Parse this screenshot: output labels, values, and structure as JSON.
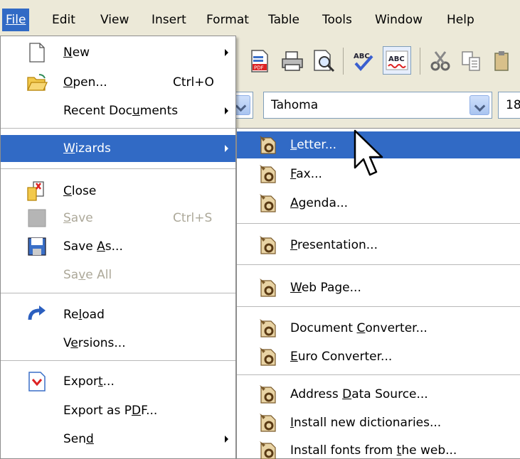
{
  "menubar": {
    "items": [
      {
        "label": "File",
        "mnemonic_index": 0
      },
      {
        "label": "Edit",
        "mnemonic_index": 0
      },
      {
        "label": "View",
        "mnemonic_index": 0
      },
      {
        "label": "Insert",
        "mnemonic_index": 0
      },
      {
        "label": "Format",
        "mnemonic_index": 1
      },
      {
        "label": "Table",
        "mnemonic_index": 1
      },
      {
        "label": "Tools",
        "mnemonic_index": 0
      },
      {
        "label": "Window",
        "mnemonic_index": 0
      },
      {
        "label": "Help",
        "mnemonic_index": 0
      }
    ]
  },
  "toolbar": {
    "font_name": "Tahoma",
    "font_size": "18"
  },
  "file_menu": {
    "items": [
      {
        "label": "New",
        "ul": "N",
        "pre": "",
        "post": "ew",
        "accel": "",
        "submenu": true
      },
      {
        "label": "Open...",
        "ul": "O",
        "pre": "",
        "post": "pen...",
        "accel": "Ctrl+O"
      },
      {
        "label": "Recent Documents",
        "ul": "u",
        "pre": "Recent Doc",
        "post": "ments",
        "submenu": true
      },
      {
        "label": "Wizards",
        "ul": "W",
        "pre": "",
        "post": "izards",
        "submenu": true,
        "highlighted": true
      },
      {
        "label": "Close",
        "ul": "C",
        "pre": "",
        "post": "lose"
      },
      {
        "label": "Save",
        "ul": "S",
        "pre": "",
        "post": "ave",
        "accel": "Ctrl+S",
        "disabled": true
      },
      {
        "label": "Save As...",
        "ul": "A",
        "pre": "Save ",
        "post": "s..."
      },
      {
        "label": "Save All",
        "ul": "v",
        "pre": "Sa",
        "post": "e All",
        "disabled": true
      },
      {
        "label": "Reload",
        "ul": "l",
        "pre": "Re",
        "post": "oad"
      },
      {
        "label": "Versions...",
        "ul": "e",
        "pre": "V",
        "post": "rsions..."
      },
      {
        "label": "Export...",
        "ul": "t",
        "pre": "Expor",
        "post": "..."
      },
      {
        "label": "Export as PDF...",
        "ul": "D",
        "pre": "Export as P",
        "post": "F..."
      },
      {
        "label": "Send",
        "ul": "d",
        "pre": "Sen",
        "post": "",
        "submenu": true
      }
    ]
  },
  "wizards_menu": {
    "items": [
      {
        "label": "Letter...",
        "ul": "L",
        "pre": "",
        "post": "etter...",
        "highlighted": true
      },
      {
        "label": "Fax...",
        "ul": "F",
        "pre": "",
        "post": "ax..."
      },
      {
        "label": "Agenda...",
        "ul": "A",
        "pre": "",
        "post": "genda..."
      },
      {
        "label": "Presentation...",
        "ul": "P",
        "pre": "",
        "post": "resentation..."
      },
      {
        "label": "Web Page...",
        "ul": "W",
        "pre": "",
        "post": "eb Page..."
      },
      {
        "label": "Document Converter...",
        "ul": "C",
        "pre": "Document ",
        "post": "onverter..."
      },
      {
        "label": "Euro Converter...",
        "ul": "E",
        "pre": "",
        "post": "uro Converter..."
      },
      {
        "label": "Address Data Source...",
        "ul": "D",
        "pre": "Address ",
        "post": "ata Source..."
      },
      {
        "label": "Install new dictionaries...",
        "ul": "I",
        "pre": "",
        "post": "nstall new dictionaries..."
      },
      {
        "label": "Install fonts from the web...",
        "ul": "t",
        "pre": "Install fonts from ",
        "post": "he web..."
      }
    ]
  },
  "colors": {
    "highlight": "#316ac5",
    "menubar_bg": "#ece9d8",
    "disabled_text": "#aca899"
  }
}
